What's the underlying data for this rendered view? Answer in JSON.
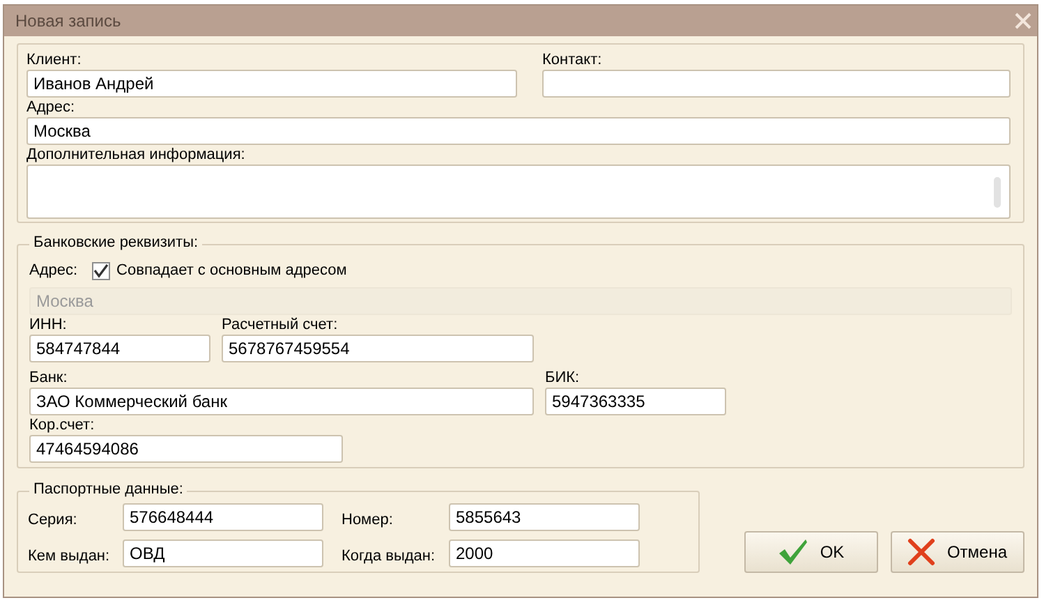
{
  "window": {
    "title": "Новая запись"
  },
  "main": {
    "client": {
      "label": "Клиент:",
      "value": "Иванов Андрей"
    },
    "contact": {
      "label": "Контакт:"
    },
    "address": {
      "label": "Адрес:",
      "value": "Москва"
    },
    "notes": {
      "label": "Дополнительная информация:"
    }
  },
  "bank": {
    "legend": "Банковские реквизиты:",
    "address_label": "Адрес:",
    "same_address": {
      "label": "Совпадает с основным адресом",
      "checked": true
    },
    "address_field": {
      "value": "Москва",
      "disabled": true
    },
    "inn": {
      "label": "ИНН:",
      "value": "584747844"
    },
    "account": {
      "label": "Расчетный счет:",
      "value": "5678767459554"
    },
    "bank_name": {
      "label": "Банк:",
      "value": "ЗАО Коммерческий банк"
    },
    "bik": {
      "label": "БИК:",
      "value": "5947363335"
    },
    "corr": {
      "label": "Кор.счет:",
      "value": "47464594086"
    }
  },
  "passport": {
    "legend": "Паспортные данные:",
    "fields": [
      {
        "label": "Серия:",
        "value": "576648444"
      },
      {
        "label": "Номер:",
        "value": "5855643"
      },
      {
        "label": "Кем выдан:",
        "value": "ОВД"
      },
      {
        "label": "Когда выдан:",
        "value": "2000"
      }
    ]
  },
  "buttons": [
    {
      "kind": "ok",
      "label": "OK"
    },
    {
      "kind": "cancel",
      "label": "Отмена"
    }
  ]
}
